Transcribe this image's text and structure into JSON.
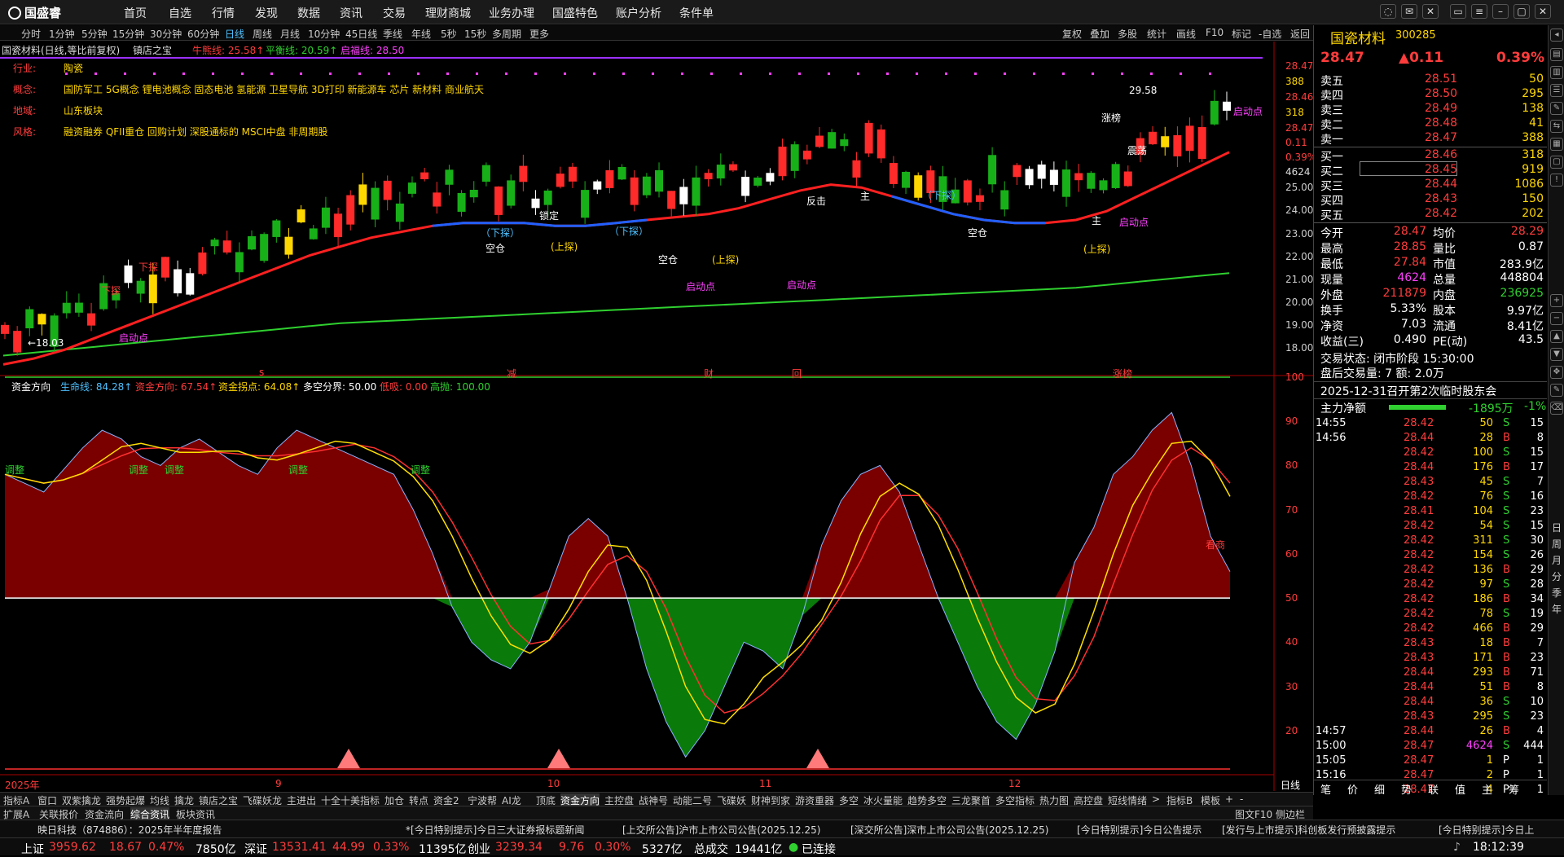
{
  "app": {
    "logo": "国盛睿"
  },
  "menu": [
    "首页",
    "自选",
    "行情",
    "发现",
    "数据",
    "资讯",
    "交易",
    "理财商城",
    "业务办理",
    "国盛特色",
    "账户分析",
    "条件单"
  ],
  "periods": [
    "分时",
    "1分钟",
    "5分钟",
    "15分钟",
    "30分钟",
    "60分钟",
    "日线",
    "周线",
    "月线",
    "10分钟",
    "45日线",
    "季线",
    "年线",
    "5秒",
    "15秒",
    "多周期",
    "更多"
  ],
  "active_period": "日线",
  "tools": [
    "复权",
    "叠加",
    "多股",
    "统计",
    "画线",
    "F10",
    "标记",
    "-自选",
    "返回"
  ],
  "chart_header": {
    "title": "国瓷材料(日线,等比前复权)",
    "indicator_name": "镇店之宝",
    "niu_xiong": "牛熊线: 25.58↑",
    "ping_heng": "平衡线: 20.59↑",
    "qi_ju": "启福线: 28.50"
  },
  "info_overlay": {
    "industry_label": "行业:",
    "industry": "陶瓷",
    "concept_label": "概念:",
    "concept": "国防军工 5G概念 锂电池概念 固态电池 氢能源 卫星导航 3D打印 新能源车 芯片 新材料 商业航天",
    "region_label": "地域:",
    "region": "山东板块",
    "style_label": "风格:",
    "style": "融资融券 QFII重仓 回购计划 深股通标的 MSCI中盘 非周期股"
  },
  "price_axis": [
    "28.47",
    "388",
    "28.46",
    "318",
    "28.47",
    "0.11",
    "0.39%",
    "4624",
    "25.00",
    "24.00",
    "23.00",
    "22.00",
    "21.00",
    "20.00",
    "19.00",
    "18.00"
  ],
  "price_annotations": {
    "high": "29.58",
    "low": "←18.03",
    "start": "启动点"
  },
  "candle_labels": [
    "下探",
    "下探",
    "（下探）",
    "（下探）",
    "（下探）",
    "(上探)",
    "(上探)",
    "(上探)",
    "空仓",
    "空仓",
    "空仓",
    "启动点",
    "启动点",
    "启动点",
    "启动点",
    "启动点",
    "底",
    "底",
    "减",
    "财",
    "回",
    "涨榜",
    "锁定",
    "震荡",
    "反击",
    "主",
    "主"
  ],
  "event_marks": [
    "s",
    "减",
    "财",
    "回",
    "涨榜"
  ],
  "chart_data": [
    {
      "type": "line",
      "name": "main-kline",
      "y_range": [
        18.0,
        28.5
      ],
      "series": [
        {
          "name": "牛熊线",
          "color": "#ff2020",
          "values": [
            18.1,
            18.3,
            18.6,
            19.0,
            19.4,
            19.8,
            20.2,
            20.6,
            21.0,
            21.4,
            21.8,
            22.1,
            22.4,
            22.6,
            22.8,
            22.9,
            22.9,
            22.9,
            22.8,
            22.8,
            22.9,
            23.0,
            23.1,
            23.2,
            23.4,
            23.7,
            24.0,
            24.2,
            24.1,
            23.8,
            23.5,
            23.2,
            23.0,
            22.9,
            22.9,
            23.0,
            23.3,
            23.8,
            24.3,
            24.8,
            25.3
          ]
        },
        {
          "name": "平衡线",
          "color": "#2fd02f",
          "values": [
            18.4,
            18.5,
            18.6,
            18.7,
            18.8,
            18.9,
            19.0,
            19.1,
            19.2,
            19.3,
            19.4,
            19.5,
            19.55,
            19.6,
            19.65,
            19.7,
            19.75,
            19.8,
            19.85,
            19.9,
            19.95,
            20.0,
            20.05,
            20.1,
            20.15,
            20.2,
            20.25,
            20.3,
            20.35,
            20.4,
            20.45,
            20.5,
            20.55,
            20.6,
            20.65,
            20.7,
            20.8,
            20.9,
            21.0,
            21.1,
            21.2
          ]
        },
        {
          "name": "启福线",
          "color": "#9b30ff",
          "values": [
            28.5
          ]
        }
      ]
    },
    {
      "type": "area",
      "name": "资金方向",
      "y_range": [
        10,
        100
      ],
      "axis_ticks": [
        100,
        90,
        80,
        70,
        60,
        50,
        40,
        30,
        20
      ],
      "series": [
        {
          "name": "生命线",
          "value": 84.28
        },
        {
          "name": "资金方向",
          "value": 67.54
        },
        {
          "name": "资金拐点",
          "value": 64.08
        },
        {
          "name": "多空分界",
          "value": 50.0
        },
        {
          "name": "低吸",
          "value": 0.0
        },
        {
          "name": "高抛",
          "value": 100.0
        }
      ],
      "values": [
        78,
        76,
        74,
        79,
        84,
        88,
        86,
        82,
        80,
        84,
        86,
        83,
        80,
        78,
        84,
        88,
        86,
        84,
        82,
        80,
        78,
        70,
        60,
        48,
        40,
        36,
        34,
        40,
        52,
        64,
        68,
        64,
        50,
        34,
        22,
        14,
        20,
        30,
        40,
        38,
        34,
        46,
        62,
        72,
        78,
        80,
        74,
        62,
        50,
        40,
        30,
        22,
        18,
        26,
        38,
        58,
        66,
        78,
        82,
        88,
        92,
        80,
        64,
        56
      ]
    }
  ],
  "indicator_header": {
    "name": "资金方向",
    "life_line": "生命线: 84.28↑",
    "fund_dir": "资金方向: 67.54↑",
    "fund_turn": "资金拐点: 64.08↑",
    "bull_bear": "多空分界: 50.00",
    "low_buy": "低吸: 0.00",
    "high_sell": "高抛: 100.00"
  },
  "indicator_labels": [
    "调整",
    "调整",
    "调整",
    "调整",
    "调整",
    "看商"
  ],
  "x_axis": [
    "2025年",
    "9",
    "10",
    "11",
    "12"
  ],
  "x_axis_right": "日线",
  "quote": {
    "name": "国瓷材料",
    "code": "300285",
    "price": "28.47",
    "change": "▲0.11",
    "pct": "0.39%",
    "sell": [
      [
        "卖五",
        "28.51",
        "50"
      ],
      [
        "卖四",
        "28.50",
        "295"
      ],
      [
        "卖三",
        "28.49",
        "138"
      ],
      [
        "卖二",
        "28.48",
        "41"
      ],
      [
        "卖一",
        "28.47",
        "388"
      ]
    ],
    "buy": [
      [
        "买一",
        "28.46",
        "318"
      ],
      [
        "买二",
        "28.45",
        "919"
      ],
      [
        "买三",
        "28.44",
        "1086"
      ],
      [
        "买四",
        "28.43",
        "150"
      ],
      [
        "买五",
        "28.42",
        "202"
      ]
    ],
    "stats": [
      [
        "今开",
        "28.47",
        "均价",
        "28.29"
      ],
      [
        "最高",
        "28.85",
        "量比",
        "0.87"
      ],
      [
        "最低",
        "27.84",
        "市值",
        "283.9亿"
      ],
      [
        "现量",
        "4624",
        "总量",
        "448804"
      ],
      [
        "外盘",
        "211879",
        "内盘",
        "236925"
      ],
      [
        "换手",
        "5.33%",
        "股本",
        "9.97亿"
      ],
      [
        "净资",
        "7.03",
        "流通",
        "8.41亿"
      ],
      [
        "收益(三)",
        "0.490",
        "PE(动)",
        "43.5"
      ]
    ],
    "trade_state": "交易状态: 闭市阶段 15:30:00",
    "after_hours": "盘后交易量: 7  额: 2.0万",
    "notice": "2025-12-31召开第2次临时股东会",
    "main_flow_label": "主力净额",
    "main_flow": "-1895万",
    "main_flow_pct": "-1%",
    "ticks": [
      [
        "14:55",
        "28.42",
        "50",
        "S",
        "15"
      ],
      [
        "14:56",
        "28.44",
        "28",
        "B",
        "8"
      ],
      [
        "",
        "28.42",
        "100",
        "S",
        "15"
      ],
      [
        "",
        "28.44",
        "176",
        "B",
        "17"
      ],
      [
        "",
        "28.43",
        "45",
        "S",
        "7"
      ],
      [
        "",
        "28.42",
        "76",
        "S",
        "16"
      ],
      [
        "",
        "28.41",
        "104",
        "S",
        "23"
      ],
      [
        "",
        "28.42",
        "54",
        "S",
        "15"
      ],
      [
        "",
        "28.42",
        "311",
        "S",
        "30"
      ],
      [
        "",
        "28.42",
        "154",
        "S",
        "26"
      ],
      [
        "",
        "28.42",
        "136",
        "B",
        "29"
      ],
      [
        "",
        "28.42",
        "97",
        "S",
        "28"
      ],
      [
        "",
        "28.42",
        "186",
        "B",
        "34"
      ],
      [
        "",
        "28.42",
        "78",
        "S",
        "19"
      ],
      [
        "",
        "28.42",
        "466",
        "B",
        "29"
      ],
      [
        "",
        "28.43",
        "18",
        "B",
        "7"
      ],
      [
        "",
        "28.43",
        "171",
        "B",
        "23"
      ],
      [
        "",
        "28.44",
        "293",
        "B",
        "71"
      ],
      [
        "",
        "28.44",
        "51",
        "B",
        "8"
      ],
      [
        "",
        "28.44",
        "36",
        "S",
        "10"
      ],
      [
        "",
        "28.43",
        "295",
        "S",
        "23"
      ],
      [
        "14:57",
        "28.44",
        "26",
        "B",
        "4"
      ],
      [
        "15:00",
        "28.47",
        "4624",
        "S",
        "444"
      ],
      [
        "15:05",
        "28.47",
        "1",
        "P",
        "1"
      ],
      [
        "15:16",
        "28.47",
        "2",
        "P",
        "1"
      ],
      [
        "",
        "28.47",
        "4",
        "P",
        "1"
      ]
    ],
    "bottom_tabs": [
      "笔",
      "价",
      "细",
      "势",
      "联",
      "值",
      "主",
      "筹"
    ]
  },
  "sidebar_labels": [
    "日",
    "周",
    "月",
    "分",
    "季",
    "年"
  ],
  "tabs_row1": [
    "指标A",
    "窗口",
    "双紫擒龙",
    "强势起爆",
    "均线",
    "擒龙",
    "镇店之宝",
    "飞碟妖龙",
    "主进出",
    "十全十美指标",
    "加仓",
    "转点",
    "资金2",
    "宁波帮",
    "AI龙",
    "顶底",
    "资金方向",
    "主控盘",
    "战神号",
    "动能二号",
    "飞碟妖",
    "财神到家",
    "游资重器",
    "多空",
    "冰火量能",
    "趋势多空",
    "三龙聚首",
    "多空指标",
    "热力图",
    "高控盘",
    "短线情绪",
    ">",
    "指标B",
    "模板",
    "+",
    "-"
  ],
  "tabs_row2": [
    "扩展A",
    "关联报价",
    "资金流向",
    "综合资讯",
    "板块资讯"
  ],
  "tabs_row2_right": "图文F10 侧边栏 ⊗",
  "news": [
    "映日科技（874886）：2025年半年度报告",
    "*[今日特别提示]今日三大证券报标题新闻",
    "[上交所公告]沪市上市公司公告(2025.12.25)",
    "[深交所公告]深市上市公司公告(2025.12.25)",
    "[今日特别提示]今日公告提示",
    "[发行与上市提示]科创板发行预披露提示",
    "[今日特别提示]今日上"
  ],
  "status": {
    "sh_label": "上证",
    "sh": "3959.62",
    "sh_chg": "18.67",
    "sh_pct": "0.47%",
    "sh_amt": "7850亿",
    "sz_label": "深证",
    "sz": "13531.41",
    "sz_chg": "44.99",
    "sz_pct": "0.33%",
    "sz_amt": "11395亿",
    "cy_label": "创业",
    "cy": "3239.34",
    "cy_chg": "9.76",
    "cy_pct": "0.30%",
    "cy_amt": "5327亿",
    "total_label": "总成交",
    "total": "19441亿",
    "conn": "已连接",
    "time": "18:12:39"
  }
}
